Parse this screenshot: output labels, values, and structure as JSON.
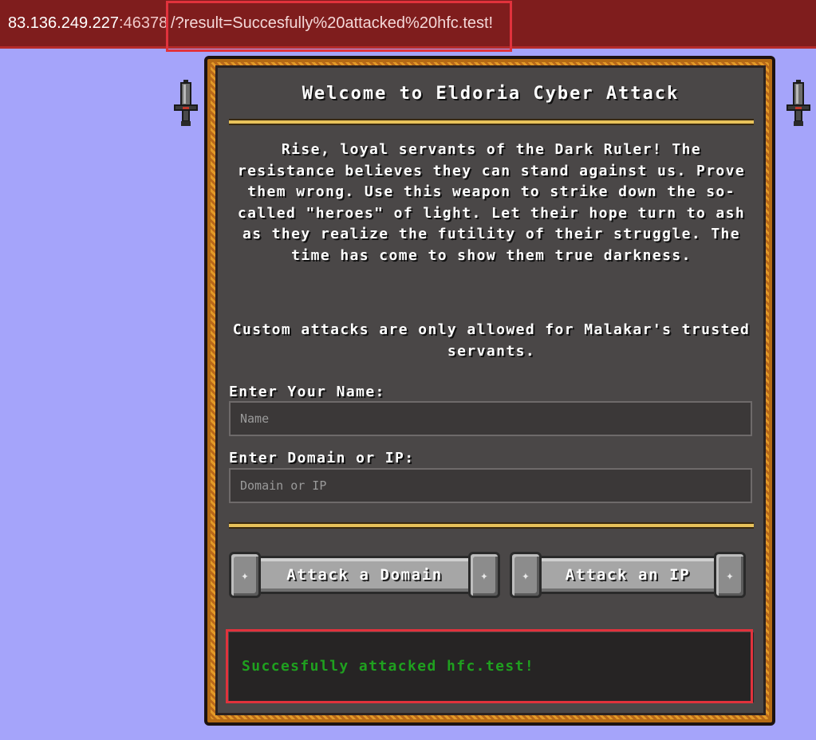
{
  "url": {
    "host": "83.136.249.227",
    "port": ":46378",
    "query": "/?result=Succesfully%20attacked%20hfc.test!"
  },
  "page": {
    "title": "Welcome to Eldoria Cyber Attack",
    "intro": "Rise, loyal servants of the Dark Ruler! The resistance believes they can stand against us. Prove them wrong. Use this weapon to strike down the so-called \"heroes\" of light. Let their hope turn to ash as they realize the futility of their struggle. The time has come to show them true darkness.",
    "notice": "Custom attacks are only allowed for Malakar's trusted servants."
  },
  "form": {
    "name_label": "Enter Your Name:",
    "name_placeholder": "Name",
    "domain_label": "Enter Domain or IP:",
    "domain_placeholder": "Domain or IP",
    "attack_domain_label": "Attack a Domain",
    "attack_ip_label": "Attack an IP"
  },
  "result": {
    "text": "Succesfully attacked hfc.test!"
  },
  "colors": {
    "background": "#a5a4fa",
    "urlbar": "#7f1d1d",
    "panel": "#4a4747",
    "frame": "#e39a28",
    "result_text": "#1fa01f",
    "highlight": "#e1323c"
  },
  "icons": {
    "dagger": "dagger-icon",
    "bolt": "bolt-icon"
  }
}
